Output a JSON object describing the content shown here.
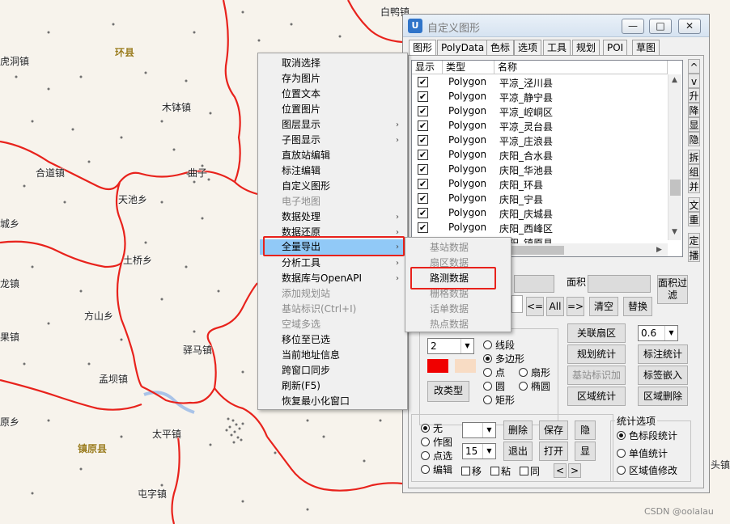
{
  "map": {
    "places": [
      {
        "name": "白鸭镇",
        "cls": ""
      },
      {
        "name": "环县",
        "cls": "city"
      },
      {
        "name": "虎洞镇",
        "cls": ""
      },
      {
        "name": "木钵镇",
        "cls": ""
      },
      {
        "name": "合道镇",
        "cls": ""
      },
      {
        "name": "曲子",
        "cls": ""
      },
      {
        "name": "天池乡",
        "cls": ""
      },
      {
        "name": "城乡",
        "cls": ""
      },
      {
        "name": "土桥乡",
        "cls": ""
      },
      {
        "name": "龙镇",
        "cls": ""
      },
      {
        "name": "方山乡",
        "cls": ""
      },
      {
        "name": "果镇",
        "cls": ""
      },
      {
        "name": "驿马镇",
        "cls": ""
      },
      {
        "name": "孟坝镇",
        "cls": ""
      },
      {
        "name": "原乡",
        "cls": ""
      },
      {
        "name": "镇原县",
        "cls": "city"
      },
      {
        "name": "太平镇",
        "cls": ""
      },
      {
        "name": "屯字镇",
        "cls": ""
      },
      {
        "name": "头镇",
        "cls": ""
      }
    ]
  },
  "context_menu": {
    "items": [
      {
        "label": "取消选择",
        "arrow": "",
        "state": ""
      },
      {
        "label": "存为图片",
        "arrow": "",
        "state": ""
      },
      {
        "label": "位置文本",
        "arrow": "",
        "state": ""
      },
      {
        "label": "位置图片",
        "arrow": "",
        "state": ""
      },
      {
        "label": "图层显示",
        "arrow": "›",
        "state": ""
      },
      {
        "label": "子图显示",
        "arrow": "›",
        "state": ""
      },
      {
        "label": "直放站编辑",
        "arrow": "",
        "state": ""
      },
      {
        "label": "标注编辑",
        "arrow": "",
        "state": ""
      },
      {
        "label": "自定义图形",
        "arrow": "",
        "state": ""
      },
      {
        "label": "电子地图",
        "arrow": "",
        "state": "disabled"
      },
      {
        "label": "数据处理",
        "arrow": "›",
        "state": ""
      },
      {
        "label": "数据还原",
        "arrow": "›",
        "state": ""
      },
      {
        "label": "全量导出",
        "arrow": "›",
        "state": "hl"
      },
      {
        "label": "分析工具",
        "arrow": "›",
        "state": ""
      },
      {
        "label": "数据库与OpenAPI",
        "arrow": "›",
        "state": ""
      },
      {
        "label": "添加规划站",
        "arrow": "",
        "state": "disabled"
      },
      {
        "label": "基站标识(Ctrl+I)",
        "arrow": "",
        "state": "disabled"
      },
      {
        "label": "空域多选",
        "arrow": "",
        "state": "disabled"
      },
      {
        "label": "移位至已选",
        "arrow": "",
        "state": ""
      },
      {
        "label": "当前地址信息",
        "arrow": "",
        "state": ""
      },
      {
        "label": "跨窗口同步",
        "arrow": "",
        "state": ""
      },
      {
        "label": "刷新(F5)",
        "arrow": "",
        "state": ""
      },
      {
        "label": "恢复最小化窗口",
        "arrow": "",
        "state": ""
      }
    ]
  },
  "submenu": {
    "items": [
      {
        "label": "基站数据",
        "enabled": false
      },
      {
        "label": "扇区数据",
        "enabled": false
      },
      {
        "label": "路测数据",
        "enabled": true
      },
      {
        "label": "栅格数据",
        "enabled": false
      },
      {
        "label": "话单数据",
        "enabled": false
      },
      {
        "label": "热点数据",
        "enabled": false
      }
    ]
  },
  "dialog": {
    "title": "自定义图形",
    "icon_glyph": "U",
    "minimize": "—",
    "maximize": "□",
    "close": "✕",
    "tabs": [
      "图形",
      "PolyData",
      "色标",
      "选项",
      "工具",
      "规划",
      "POI",
      "草图"
    ],
    "list": {
      "headers": [
        "显示",
        "类型",
        "名称"
      ],
      "check": "✔",
      "rows": [
        {
          "type": "Polygon",
          "name": "平凉_泾川县"
        },
        {
          "type": "Polygon",
          "name": "平凉_静宁县"
        },
        {
          "type": "Polygon",
          "name": "平凉_崆峒区"
        },
        {
          "type": "Polygon",
          "name": "平凉_灵台县"
        },
        {
          "type": "Polygon",
          "name": "平凉_庄浪县"
        },
        {
          "type": "Polygon",
          "name": "庆阳_合水县"
        },
        {
          "type": "Polygon",
          "name": "庆阳_华池县"
        },
        {
          "type": "Polygon",
          "name": "庆阳_环县"
        },
        {
          "type": "Polygon",
          "name": "庆阳_宁县"
        },
        {
          "type": "Polygon",
          "name": "庆阳_庆城县"
        },
        {
          "type": "Polygon",
          "name": "庆阳_西峰区"
        },
        {
          "type": "Polygon",
          "name": "庆阳_镇原县"
        }
      ]
    },
    "side_buttons": [
      "^",
      "v",
      "升",
      "降",
      "显",
      "隐",
      "拆",
      "组",
      "并",
      "文",
      "重",
      "定",
      "播"
    ],
    "area_label": "面积",
    "area_filter": "面积过滤",
    "btn_left": "<=",
    "btn_all": "All",
    "btn_right": "=>",
    "btn_clear": "清空",
    "btn_replace": "替换",
    "style": {
      "line_width": "2",
      "fill_color": "#f00000",
      "alt_color": "#f8dcc4",
      "change_type": "改类型",
      "shapes": [
        "线段",
        "多边形",
        "点",
        "扇形",
        "圆",
        "椭圆",
        "矩形"
      ]
    },
    "tools": {
      "link_sector": "关联扇区",
      "opacity": "0.6",
      "plan_stats": "规划统计",
      "label_stats": "标注统计",
      "site_mark": "基站标识加",
      "label_embed": "标签嵌入",
      "region_stats": "区域统计",
      "region_delete": "区域删除"
    },
    "bottom": {
      "modes": [
        "无",
        "作图",
        "点选",
        "编辑"
      ],
      "font_size": "15",
      "delete": "删除",
      "save": "保存",
      "hide": "隐",
      "exit": "退出",
      "open": "打开",
      "show": "显",
      "move": "移",
      "paste": "粘",
      "same": "同",
      "prev": "<",
      "next": ">",
      "stats_group": "统计选项",
      "stats_opts": [
        "色标段统计",
        "单值统计",
        "区域值修改"
      ]
    }
  },
  "watermark": "CSDN @oolalau"
}
